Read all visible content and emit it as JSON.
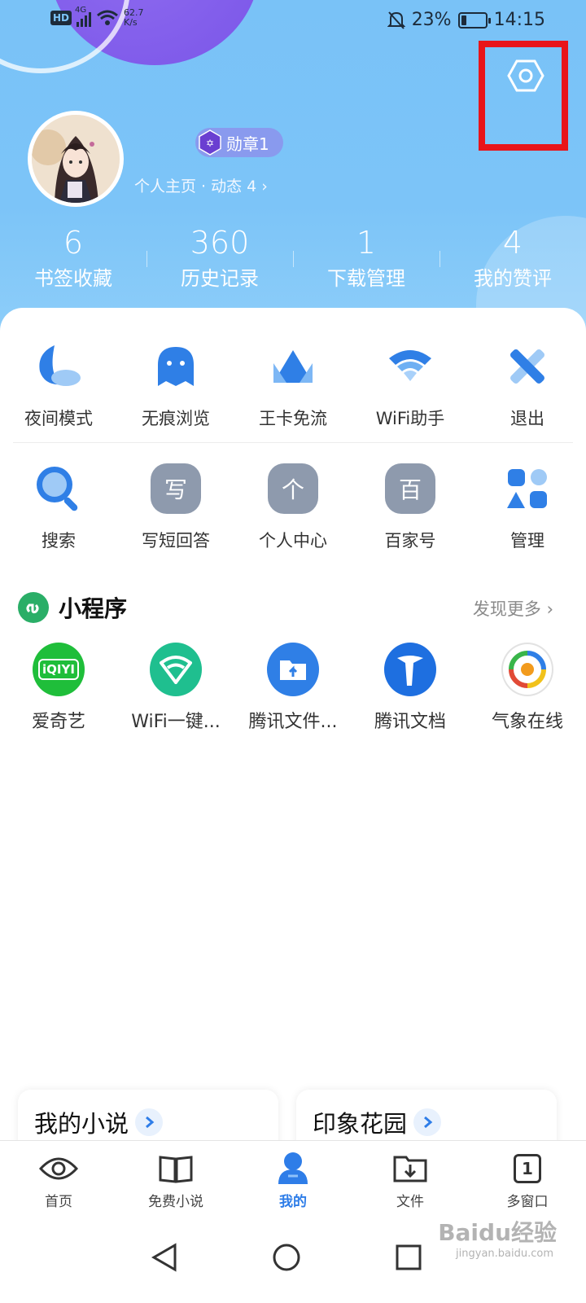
{
  "status_bar": {
    "hd": "HD",
    "signal": "4G",
    "speed": "62.7",
    "speed_unit": "K/s",
    "battery_pct": "23%",
    "battery_level": 0.23,
    "time": "14:15"
  },
  "profile": {
    "medal_label": "勋章1",
    "link_text": "个人主页 · 动态 4"
  },
  "stats": [
    {
      "value": "6",
      "label": "书签收藏"
    },
    {
      "value": "360",
      "label": "历史记录"
    },
    {
      "value": "1",
      "label": "下载管理"
    },
    {
      "value": "4",
      "label": "我的赞评"
    }
  ],
  "grid_row1": [
    {
      "label": "夜间模式",
      "icon": "moon-icon"
    },
    {
      "label": "无痕浏览",
      "icon": "ghost-icon"
    },
    {
      "label": "王卡免流",
      "icon": "crown-icon"
    },
    {
      "label": "WiFi助手",
      "icon": "wifi-icon"
    },
    {
      "label": "退出",
      "icon": "exit-icon"
    }
  ],
  "grid_row2": [
    {
      "label": "搜索",
      "icon": "search-icon"
    },
    {
      "label": "写短回答",
      "icon": "write-icon",
      "glyph": "写"
    },
    {
      "label": "个人中心",
      "icon": "personal-center-icon",
      "glyph": "个"
    },
    {
      "label": "百家号",
      "icon": "baijiahao-icon",
      "glyph": "百"
    },
    {
      "label": "管理",
      "icon": "manage-icon"
    }
  ],
  "mini_programs": {
    "title": "小程序",
    "more": "发现更多",
    "items": [
      {
        "label": "爱奇艺",
        "icon": "iqiyi-icon",
        "logo_text": "iQIYI"
      },
      {
        "label": "WiFi一键...",
        "icon": "wifi-key-icon"
      },
      {
        "label": "腾讯文件...",
        "icon": "tencent-file-icon"
      },
      {
        "label": "腾讯文档",
        "icon": "tencent-docs-icon"
      },
      {
        "label": "气象在线",
        "icon": "weather-icon"
      }
    ]
  },
  "cards": [
    {
      "label": "我的小说"
    },
    {
      "label": "印象花园"
    }
  ],
  "tabs": [
    {
      "label": "首页",
      "icon": "eye-icon"
    },
    {
      "label": "免费小说",
      "icon": "book-icon"
    },
    {
      "label": "我的",
      "icon": "user-icon",
      "active": true
    },
    {
      "label": "文件",
      "icon": "folder-download-icon"
    },
    {
      "label": "多窗口",
      "icon": "windows-icon",
      "count": "1"
    }
  ],
  "watermark": {
    "text": "Baidu经验",
    "sub": "jingyan.baidu.com"
  },
  "colors": {
    "accent": "#2e7de8",
    "header": "#7cc4f8",
    "highlight_box": "#e8141a"
  }
}
